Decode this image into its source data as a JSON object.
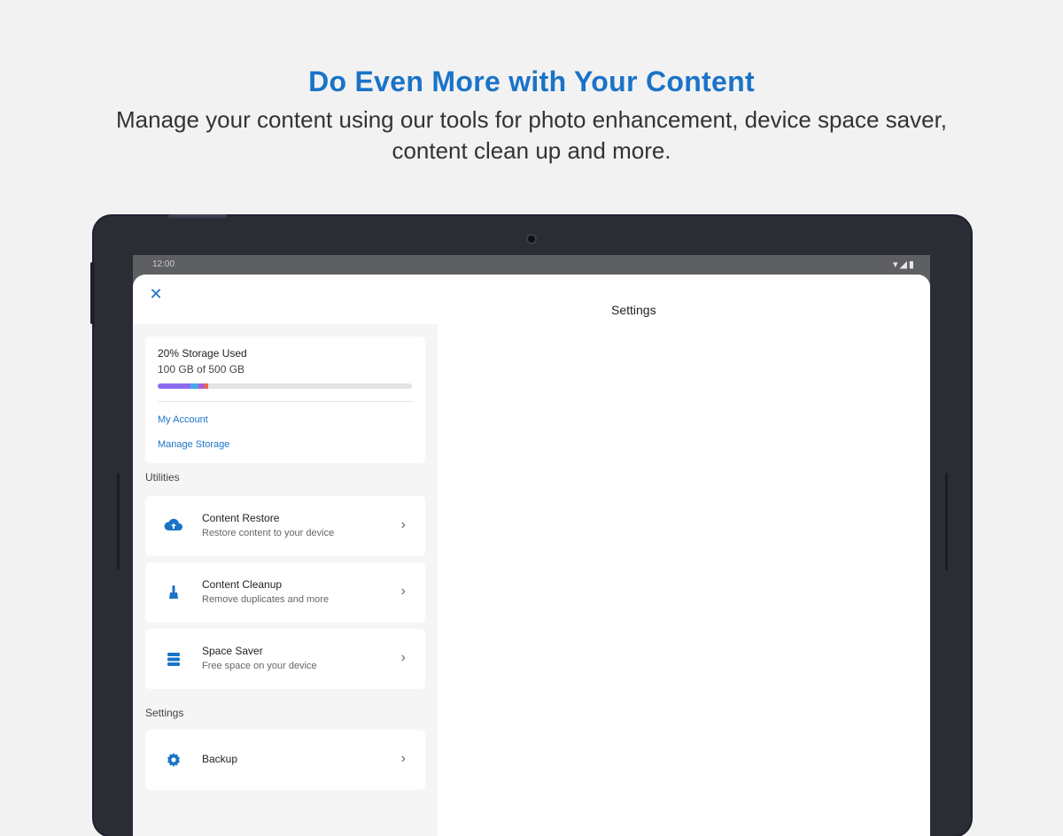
{
  "promo": {
    "title": "Do Even More with Your Content",
    "subtitle": "Manage your content using our tools for photo enhancement, device space saver, content clean up and more."
  },
  "statusbar": {
    "time": "12:00",
    "icons": "▾◢▮"
  },
  "sheet": {
    "close_icon": "✕",
    "header": "Settings"
  },
  "storage": {
    "title": "20% Storage Used",
    "size": "100 GB of 500 GB",
    "used_fraction": 0.2,
    "segments": [
      {
        "color": "#8c6cf0",
        "fraction": 0.13
      },
      {
        "color": "#4aa8e8",
        "fraction": 0.03
      },
      {
        "color": "#b05ad8",
        "fraction": 0.025
      },
      {
        "color": "#f06a3c",
        "fraction": 0.015
      }
    ],
    "links": [
      "My Account",
      "Manage Storage"
    ]
  },
  "utilities": {
    "label": "Utilities",
    "items": [
      {
        "icon": "cloud-restore-icon",
        "title": "Content Restore",
        "desc": "Restore content to your device"
      },
      {
        "icon": "brush-icon",
        "title": "Content Cleanup",
        "desc": "Remove duplicates and more"
      },
      {
        "icon": "storage-stack-icon",
        "title": "Space Saver",
        "desc": "Free space on your device"
      }
    ]
  },
  "settings": {
    "label": "Settings",
    "items": [
      {
        "icon": "gear-icon",
        "title": "Backup"
      }
    ]
  },
  "colors": {
    "accent": "#1a73c8"
  }
}
